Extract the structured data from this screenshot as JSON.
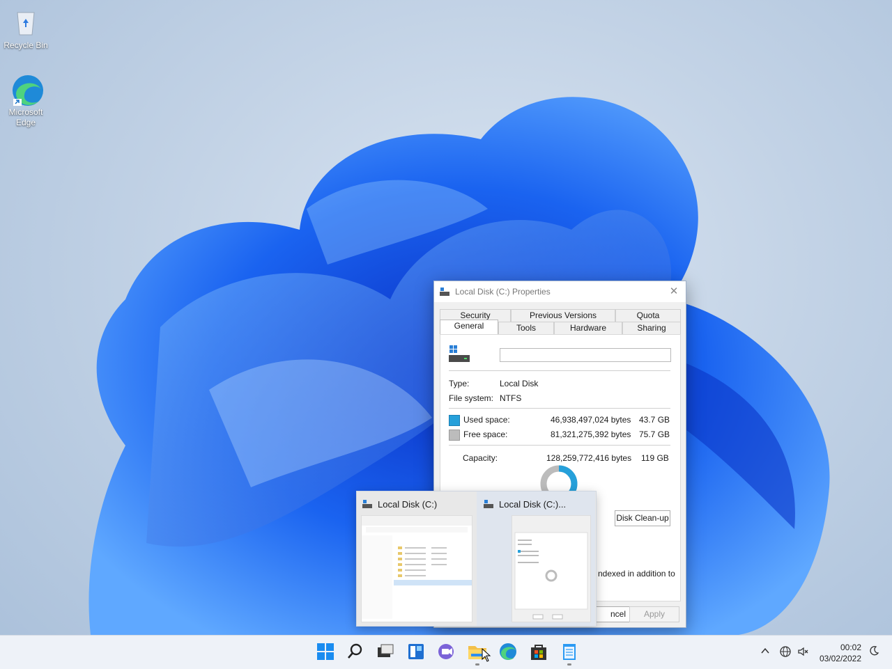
{
  "desktop": {
    "icons": [
      {
        "label": "Recycle Bin"
      },
      {
        "label": "Microsoft\nEdge"
      }
    ]
  },
  "dialog": {
    "title": "Local Disk (C:) Properties",
    "tabs_top": [
      "Security",
      "Previous Versions",
      "Quota"
    ],
    "tabs_bottom": [
      "General",
      "Tools",
      "Hardware",
      "Sharing"
    ],
    "active_tab": "General",
    "name_value": "",
    "type_label": "Type:",
    "type_value": "Local Disk",
    "fs_label": "File system:",
    "fs_value": "NTFS",
    "used_label": "Used space:",
    "used_bytes": "46,938,497,024 bytes",
    "used_gb": "43.7 GB",
    "free_label": "Free space:",
    "free_bytes": "81,321,275,392 bytes",
    "free_gb": "75.7 GB",
    "cap_label": "Capacity:",
    "cap_bytes": "128,259,772,416 bytes",
    "cap_gb": "119 GB",
    "used_fraction": 0.366,
    "cleanup_button": "Disk Clean-up",
    "index_text_partial": "ndexed in addition to",
    "cancel_partial": "ncel",
    "apply_button": "Apply",
    "colors": {
      "used": "#26a0da",
      "free": "#bcbcbc"
    }
  },
  "thumbnails": [
    {
      "label": "Local Disk (C:)"
    },
    {
      "label": "Local Disk (C:)..."
    }
  ],
  "taskbar": {
    "icons": [
      "start-icon",
      "search-icon",
      "task-view-icon",
      "widgets-icon",
      "chat-icon",
      "file-explorer-icon",
      "edge-icon",
      "store-icon",
      "notepad-icon"
    ],
    "clock_time": "00:02",
    "clock_date": "03/02/2022"
  }
}
